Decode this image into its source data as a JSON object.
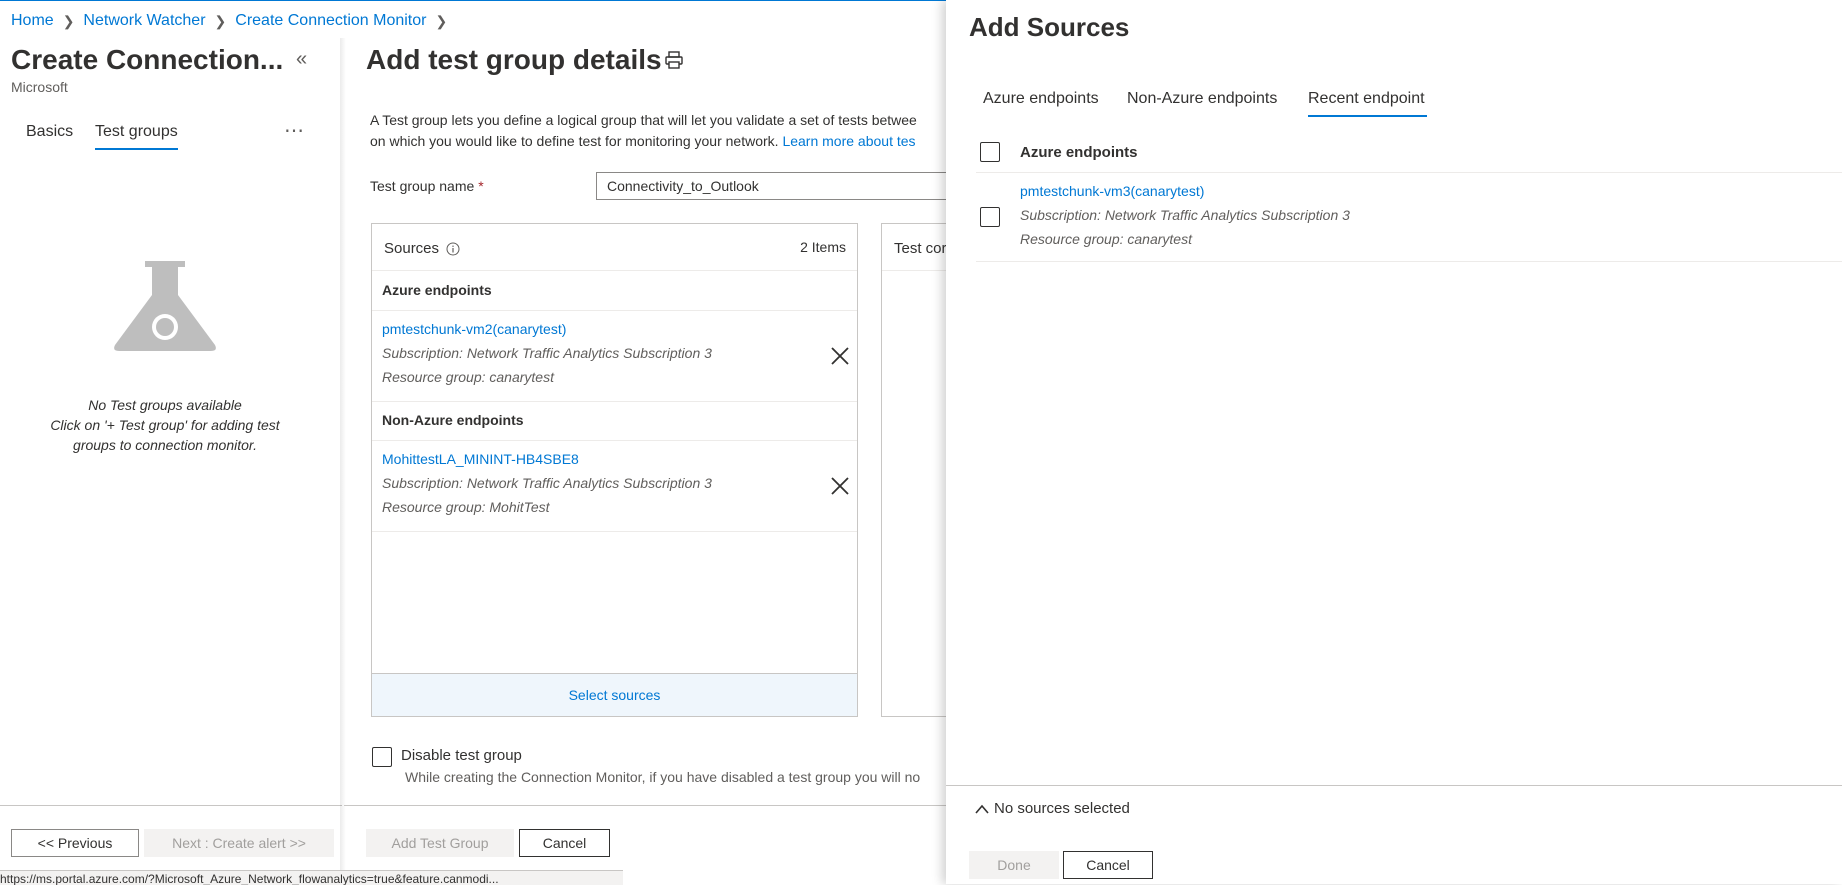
{
  "breadcrumb": [
    "Home",
    "Network Watcher",
    "Create Connection Monitor"
  ],
  "left_blade": {
    "title": "Create Connection...",
    "subtitle": "Microsoft",
    "tabs": [
      {
        "label": "Basics"
      },
      {
        "label": "Test groups"
      }
    ],
    "active_tab": "Test groups",
    "empty_state": {
      "line1": "No Test groups available",
      "line2": "Click on '+ Test group' for adding test",
      "line3": "groups to connection monitor."
    },
    "buttons": {
      "previous": "<< Previous",
      "next": "Next : Create alert >>"
    }
  },
  "middle_blade": {
    "title": "Add test group details",
    "description_line1": "A Test group lets you define a logical group that will let you validate a set of tests betwee",
    "description_line2": "on which you would like to define test for monitoring your network.",
    "learn_more": "Learn more about tes",
    "test_group_name_label": "Test group name",
    "required_marker": "*",
    "test_group_name_value": "Connectivity_to_Outlook",
    "sources": {
      "title": "Sources",
      "count": "2 Items",
      "groups": [
        {
          "heading": "Azure endpoints",
          "items": [
            {
              "name": "pmtestchunk-vm2(canarytest)",
              "subscription": "Subscription: Network Traffic Analytics Subscription 3",
              "resource_group": "Resource group: canarytest"
            }
          ]
        },
        {
          "heading": "Non-Azure endpoints",
          "items": [
            {
              "name": "MohittestLA_MININT-HB4SBE8",
              "subscription": "Subscription: Network Traffic Analytics Subscription 3",
              "resource_group": "Resource group: MohitTest"
            }
          ]
        }
      ],
      "select_label": "Select sources"
    },
    "test_card_title": "Test cor",
    "disable_label": "Disable test group",
    "disable_help": "While creating the Connection Monitor, if you have disabled a test group you will no",
    "buttons": {
      "add": "Add Test Group",
      "cancel": "Cancel"
    }
  },
  "status_url": "https://ms.portal.azure.com/?Microsoft_Azure_Network_flowanalytics=true&feature.canmodi...",
  "right_panel": {
    "title": "Add Sources",
    "tabs": [
      {
        "label": "Azure endpoints"
      },
      {
        "label": "Non-Azure endpoints"
      },
      {
        "label": "Recent endpoint"
      }
    ],
    "active_tab": "Recent endpoint",
    "list_header": "Azure endpoints",
    "items": [
      {
        "name": "pmtestchunk-vm3(canarytest)",
        "subscription": "Subscription: Network Traffic Analytics Subscription 3",
        "resource_group": "Resource group: canarytest"
      }
    ],
    "summary": "No sources selected",
    "buttons": {
      "done": "Done",
      "cancel": "Cancel"
    }
  },
  "colors": {
    "accent": "#0078d4",
    "required": "#a4262c",
    "select_bg": "#eff6fc"
  },
  "icons": [
    "chevron-right-icon",
    "collapse-icon",
    "more-icon",
    "flask-icon",
    "print-icon",
    "info-icon",
    "close-icon",
    "chevron-up-icon"
  ]
}
